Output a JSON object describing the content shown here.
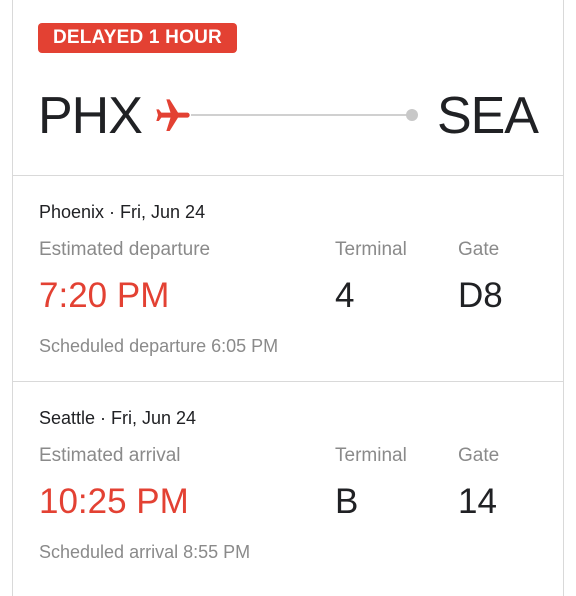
{
  "status": {
    "badge": "DELAYED 1 HOUR",
    "color": "#e34133"
  },
  "route": {
    "origin": "PHX",
    "destination": "SEA",
    "icon": "airplane-icon"
  },
  "departure": {
    "header": "Phoenix · Fri, Jun 24",
    "estimated_label": "Estimated departure",
    "estimated_time": "7:20 PM",
    "terminal_label": "Terminal",
    "terminal": "4",
    "gate_label": "Gate",
    "gate": "D8",
    "scheduled": "Scheduled departure 6:05 PM"
  },
  "arrival": {
    "header": "Seattle · Fri, Jun 24",
    "estimated_label": "Estimated arrival",
    "estimated_time": "10:25 PM",
    "terminal_label": "Terminal",
    "terminal": "B",
    "gate_label": "Gate",
    "gate": "14",
    "scheduled": "Scheduled arrival 8:55 PM"
  }
}
